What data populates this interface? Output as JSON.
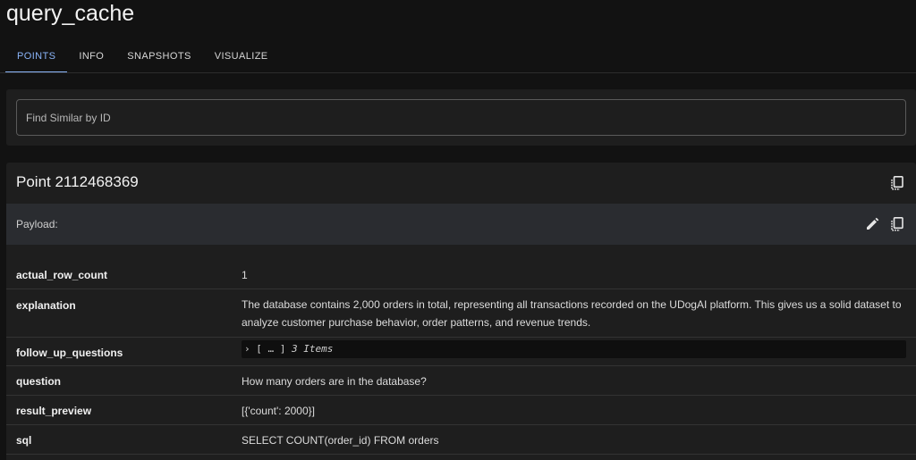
{
  "title": "query_cache",
  "tabs": [
    {
      "label": "POINTS",
      "active": true
    },
    {
      "label": "INFO"
    },
    {
      "label": "SNAPSHOTS"
    },
    {
      "label": "VISUALIZE"
    }
  ],
  "search": {
    "placeholder": "Find Similar by ID"
  },
  "point": {
    "title": "Point 2112468369",
    "payload_label": "Payload:",
    "icons": {
      "copy": "copy-icon",
      "edit": "pencil-icon"
    },
    "fields": [
      {
        "key": "actual_row_count",
        "value": "1"
      },
      {
        "key": "explanation",
        "value": "The database contains 2,000 orders in total, representing all transactions recorded on the UDogAI platform. This gives us a solid dataset to analyze customer purchase behavior, order patterns, and revenue trends."
      },
      {
        "key": "follow_up_questions",
        "value_prefix": "›",
        "value_brackets": "[ … ]",
        "value_count": "3 Items"
      },
      {
        "key": "question",
        "value": "How many orders are in the database?"
      },
      {
        "key": "result_preview",
        "value": "[{'count': 2000}]"
      },
      {
        "key": "sql",
        "value": "SELECT COUNT(order_id) FROM orders"
      }
    ]
  },
  "colors": {
    "accent": "#8ab4f8",
    "background": "#121212",
    "card": "#1e1e1e"
  }
}
